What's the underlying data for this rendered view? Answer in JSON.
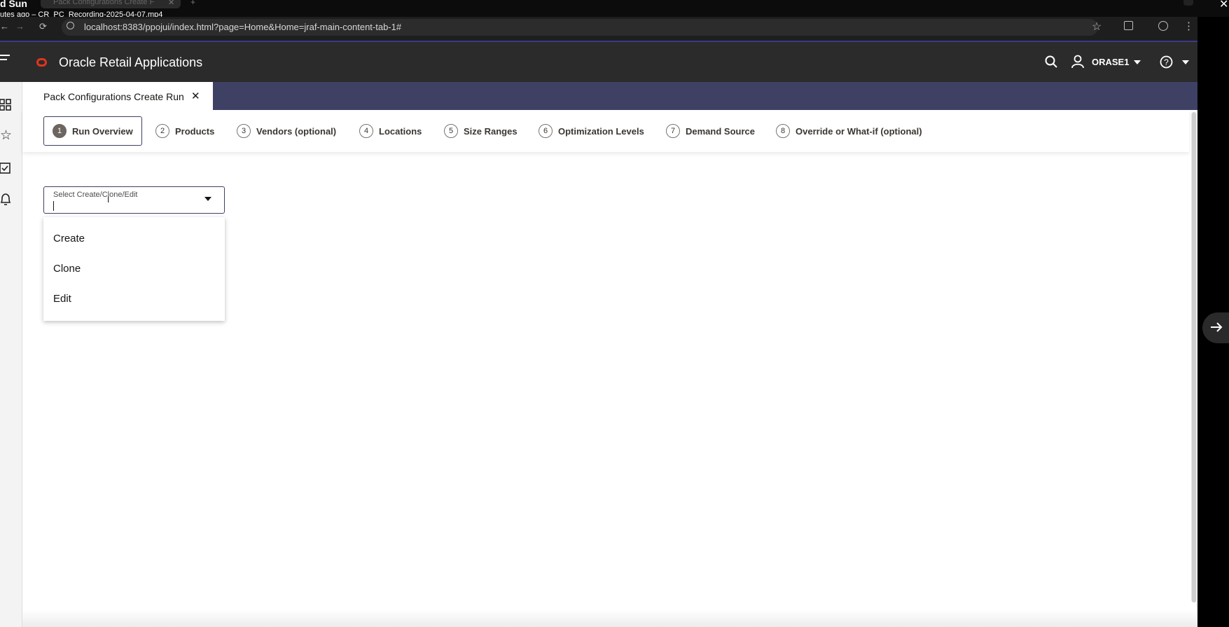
{
  "recording": {
    "title": "d Sun",
    "subtitle": "utes ago – CR_PC_Recording-2025-04-07.mp4",
    "tab_title": "Pack Configurations Create F",
    "close_glyph": "✕"
  },
  "browser": {
    "url": "localhost:8383/ppojui/index.html?page=Home&Home=jraf-main-content-tab-1#"
  },
  "app": {
    "title": "Oracle Retail Applications",
    "user": "ORASE1"
  },
  "tab": {
    "label": "Pack Configurations Create Run",
    "close": "✕"
  },
  "train": {
    "steps": [
      {
        "num": "1",
        "label": "Run Overview"
      },
      {
        "num": "2",
        "label": "Products"
      },
      {
        "num": "3",
        "label": "Vendors (optional)"
      },
      {
        "num": "4",
        "label": "Locations"
      },
      {
        "num": "5",
        "label": "Size Ranges"
      },
      {
        "num": "6",
        "label": "Optimization Levels"
      },
      {
        "num": "7",
        "label": "Demand Source"
      },
      {
        "num": "8",
        "label": "Override or What-if (optional)"
      }
    ]
  },
  "select": {
    "label": "Select Create/Clone/Edit",
    "options": [
      "Create",
      "Clone",
      "Edit"
    ]
  },
  "colors": {
    "header": "#2b2b2b",
    "tabbar": "#3e4164",
    "oracle_red": "#e1341e"
  }
}
